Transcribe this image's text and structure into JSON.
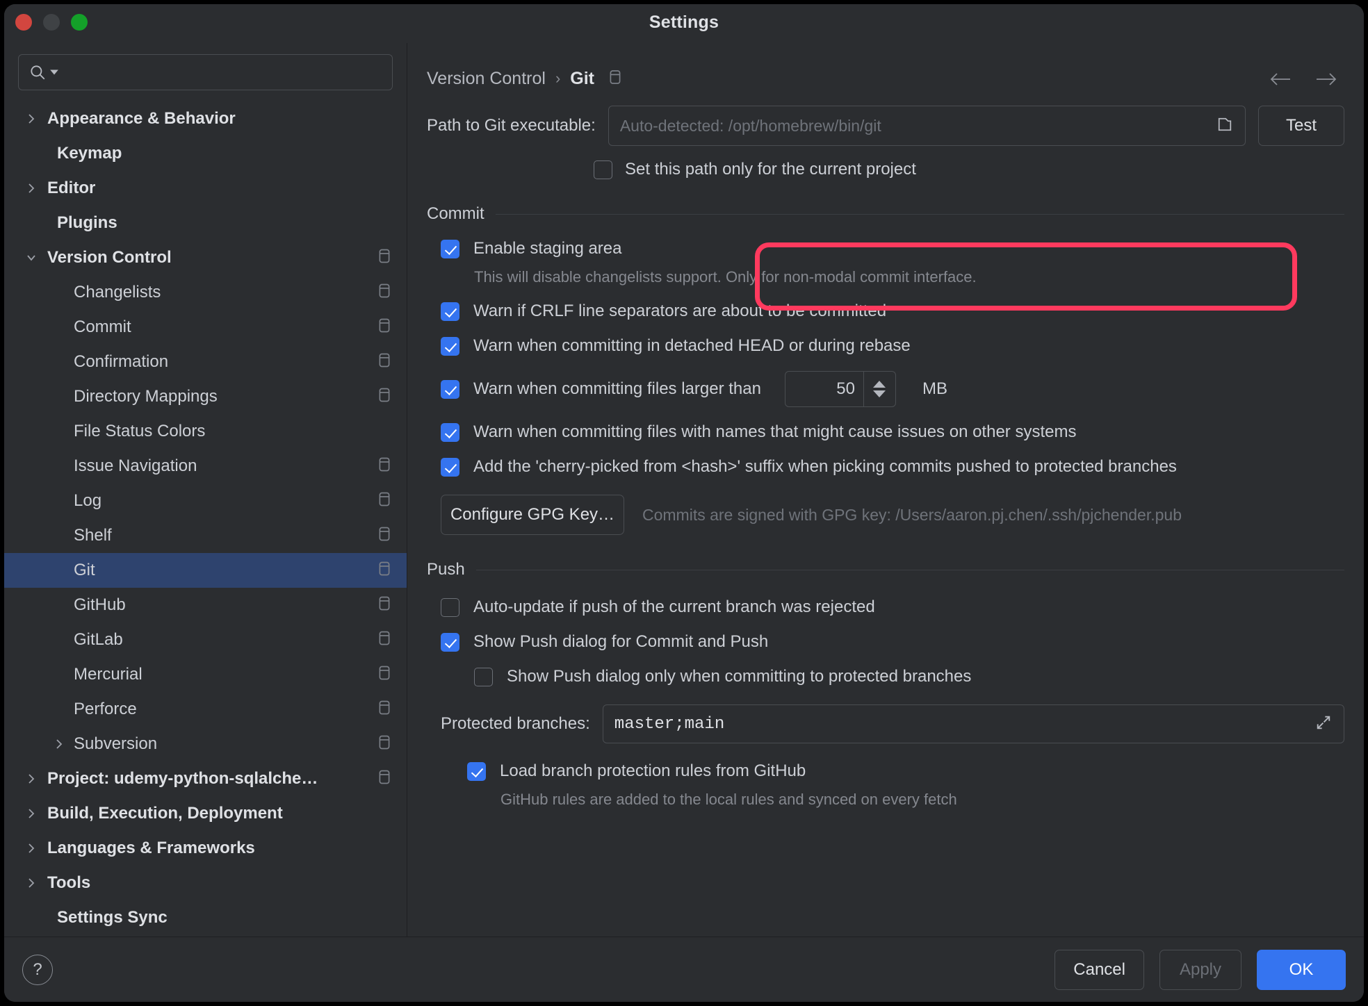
{
  "window": {
    "title": "Settings"
  },
  "search": {
    "value": "",
    "placeholder": ""
  },
  "sidebar": {
    "items": [
      {
        "label": "Appearance & Behavior",
        "level": 0,
        "arrow": "right",
        "bold": true,
        "badge": false,
        "selected": false
      },
      {
        "label": "Keymap",
        "level": 0,
        "arrow": "none",
        "bold": true,
        "badge": false,
        "selected": false
      },
      {
        "label": "Editor",
        "level": 0,
        "arrow": "right",
        "bold": true,
        "badge": false,
        "selected": false
      },
      {
        "label": "Plugins",
        "level": 0,
        "arrow": "none",
        "bold": true,
        "badge": false,
        "selected": false
      },
      {
        "label": "Version Control",
        "level": 0,
        "arrow": "down",
        "bold": true,
        "badge": true,
        "selected": false
      },
      {
        "label": "Changelists",
        "level": 1,
        "arrow": "none",
        "bold": false,
        "badge": true,
        "selected": false
      },
      {
        "label": "Commit",
        "level": 1,
        "arrow": "none",
        "bold": false,
        "badge": true,
        "selected": false
      },
      {
        "label": "Confirmation",
        "level": 1,
        "arrow": "none",
        "bold": false,
        "badge": true,
        "selected": false
      },
      {
        "label": "Directory Mappings",
        "level": 1,
        "arrow": "none",
        "bold": false,
        "badge": true,
        "selected": false
      },
      {
        "label": "File Status Colors",
        "level": 1,
        "arrow": "none",
        "bold": false,
        "badge": false,
        "selected": false
      },
      {
        "label": "Issue Navigation",
        "level": 1,
        "arrow": "none",
        "bold": false,
        "badge": true,
        "selected": false
      },
      {
        "label": "Log",
        "level": 1,
        "arrow": "none",
        "bold": false,
        "badge": true,
        "selected": false
      },
      {
        "label": "Shelf",
        "level": 1,
        "arrow": "none",
        "bold": false,
        "badge": true,
        "selected": false
      },
      {
        "label": "Git",
        "level": 1,
        "arrow": "none",
        "bold": false,
        "badge": true,
        "selected": true
      },
      {
        "label": "GitHub",
        "level": 1,
        "arrow": "none",
        "bold": false,
        "badge": true,
        "selected": false
      },
      {
        "label": "GitLab",
        "level": 1,
        "arrow": "none",
        "bold": false,
        "badge": true,
        "selected": false
      },
      {
        "label": "Mercurial",
        "level": 1,
        "arrow": "none",
        "bold": false,
        "badge": true,
        "selected": false
      },
      {
        "label": "Perforce",
        "level": 1,
        "arrow": "none",
        "bold": false,
        "badge": true,
        "selected": false
      },
      {
        "label": "Subversion",
        "level": 1,
        "arrow": "right",
        "bold": false,
        "badge": true,
        "selected": false
      },
      {
        "label": "Project: udemy-python-sqlalche…",
        "level": 0,
        "arrow": "right",
        "bold": true,
        "badge": true,
        "selected": false
      },
      {
        "label": "Build, Execution, Deployment",
        "level": 0,
        "arrow": "right",
        "bold": true,
        "badge": false,
        "selected": false
      },
      {
        "label": "Languages & Frameworks",
        "level": 0,
        "arrow": "right",
        "bold": true,
        "badge": false,
        "selected": false
      },
      {
        "label": "Tools",
        "level": 0,
        "arrow": "right",
        "bold": true,
        "badge": false,
        "selected": false
      },
      {
        "label": "Settings Sync",
        "level": 0,
        "arrow": "none",
        "bold": true,
        "badge": false,
        "selected": false
      }
    ]
  },
  "breadcrumb": {
    "parent": "Version Control",
    "separator": "›",
    "current": "Git"
  },
  "git_path": {
    "label": "Path to Git executable:",
    "placeholder": "Auto-detected: /opt/homebrew/bin/git",
    "value": "",
    "test_button": "Test",
    "project_only": {
      "label": "Set this path only for the current project",
      "checked": false
    }
  },
  "commit": {
    "section_title": "Commit",
    "staging": {
      "label": "Enable staging area",
      "checked": true,
      "description": "This will disable changelists support. Only for non-modal commit interface.",
      "highlight_color": "#ff3a5e"
    },
    "options": [
      {
        "label": "Warn if CRLF line separators are about to be committed",
        "checked": true
      },
      {
        "label": "Warn when committing in detached HEAD or during rebase",
        "checked": true
      }
    ],
    "file_size": {
      "label": "Warn when committing files larger than",
      "checked": true,
      "value": "50",
      "unit": "MB"
    },
    "options2": [
      {
        "label": "Warn when committing files with names that might cause issues on other systems",
        "checked": true
      },
      {
        "label": "Add the 'cherry-picked from <hash>' suffix when picking commits pushed to protected branches",
        "checked": true
      }
    ],
    "gpg": {
      "button": "Configure GPG Key…",
      "note": "Commits are signed with GPG key: /Users/aaron.pj.chen/.ssh/pjchender.pub"
    }
  },
  "push": {
    "section_title": "Push",
    "options": [
      {
        "label": "Auto-update if push of the current branch was rejected",
        "checked": false,
        "indent": false
      },
      {
        "label": "Show Push dialog for Commit and Push",
        "checked": true,
        "indent": false
      },
      {
        "label": "Show Push dialog only when committing to protected branches",
        "checked": false,
        "indent": true
      }
    ],
    "protected_branches": {
      "label": "Protected branches:",
      "value": "master;main"
    },
    "github_rules": {
      "label": "Load branch protection rules from GitHub",
      "checked": true,
      "note": "GitHub rules are added to the local rules and synced on every fetch"
    }
  },
  "footer": {
    "help": "?",
    "cancel": "Cancel",
    "apply": "Apply",
    "ok": "OK",
    "accent": "#3574f0"
  }
}
